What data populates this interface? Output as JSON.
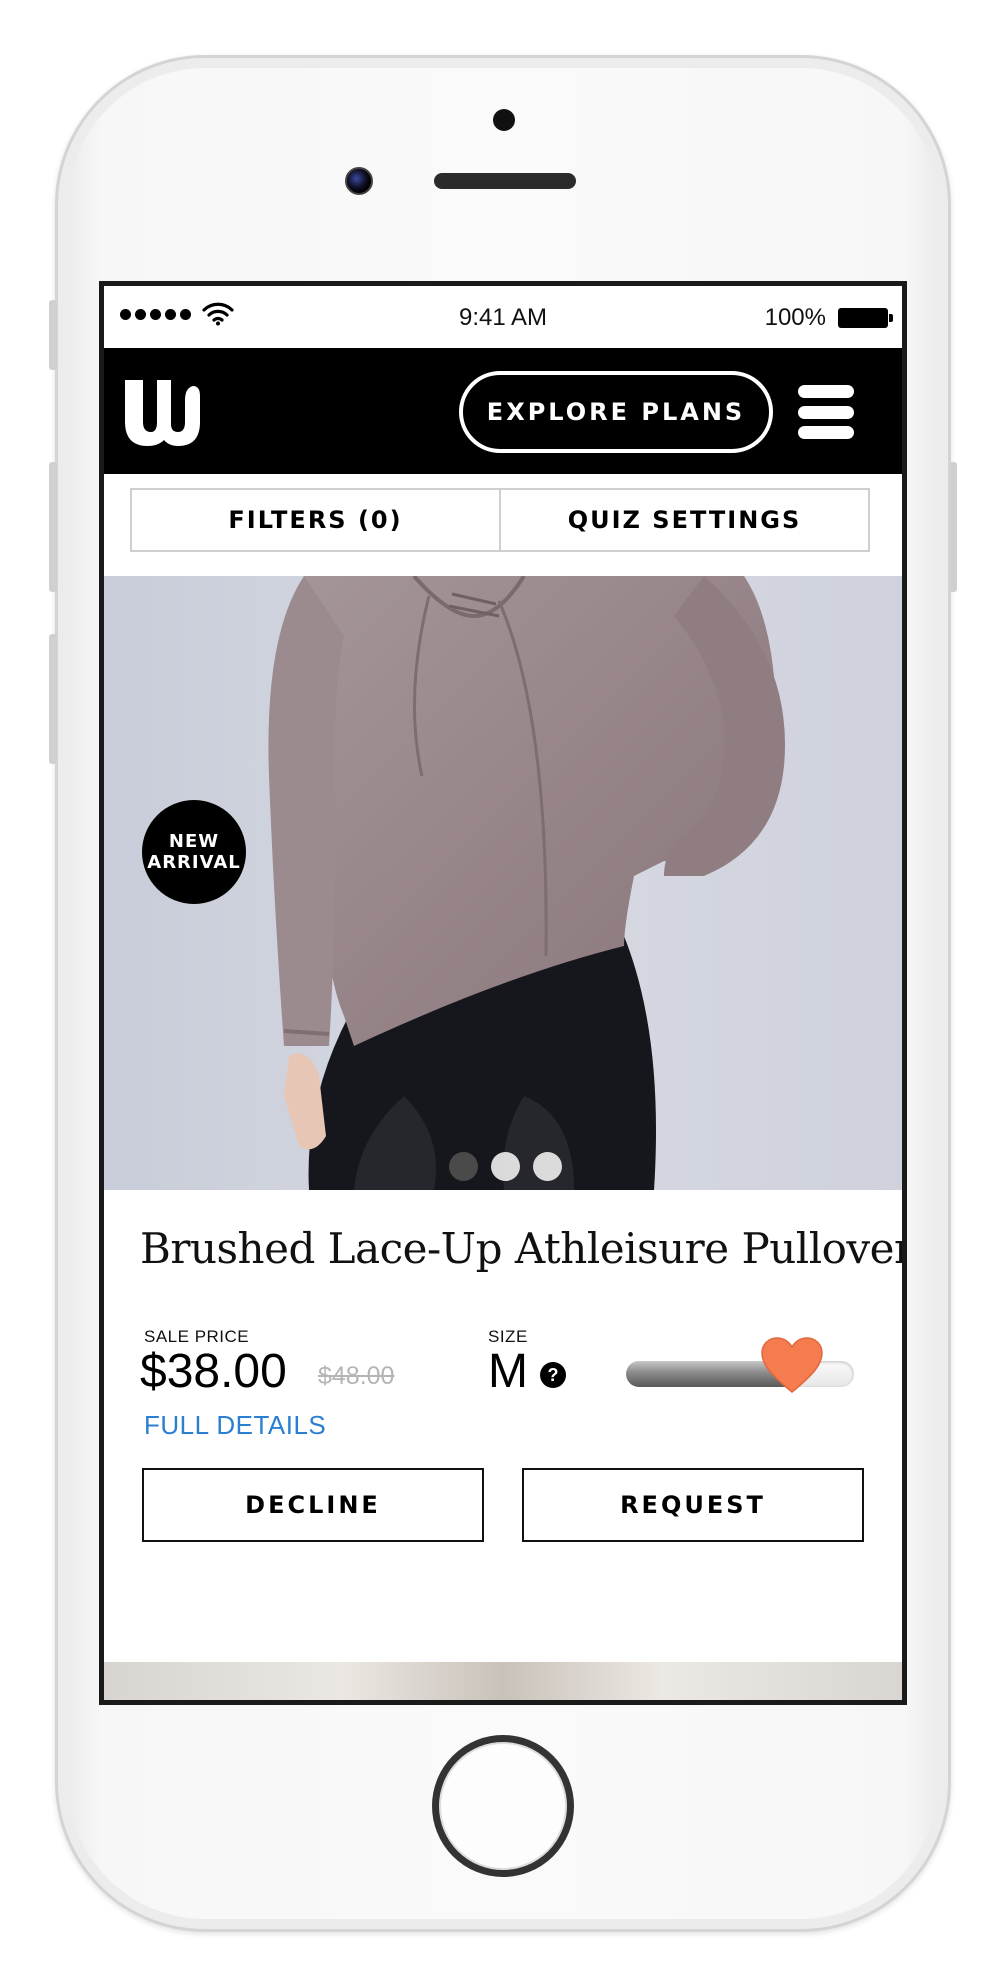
{
  "status_bar": {
    "time": "9:41 AM",
    "battery": "100%"
  },
  "header": {
    "logo_letter": "W",
    "explore_label": "EXPLORE PLANS"
  },
  "filters": {
    "filters_label": "FILTERS (0)",
    "quiz_label": "QUIZ SETTINGS"
  },
  "product": {
    "badge_line1": "NEW",
    "badge_line2": "ARRIVAL",
    "carousel_total": 3,
    "carousel_active": 1,
    "title": "Brushed Lace-Up Athleisure Pullover",
    "sale_price_label": "SALE PRICE",
    "sale_price": "$38.00",
    "original_price": "$48.00",
    "size_label": "SIZE",
    "size": "M",
    "help_glyph": "?",
    "like_level": 0.72,
    "full_details_label": "FULL DETAILS"
  },
  "actions": {
    "decline_label": "DECLINE",
    "request_label": "REQUEST"
  },
  "colors": {
    "accent_heart": "#f47c4f",
    "link": "#2a7fd0",
    "nav_background": "#000000"
  }
}
